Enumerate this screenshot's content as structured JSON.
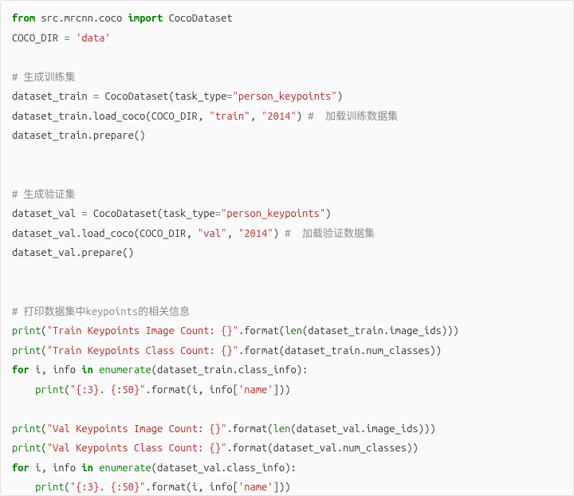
{
  "code": {
    "lines": [
      {
        "html": "<span class='kw'>from</span> src.mrcnn.coco <span class='kw'>import</span> CocoDataset"
      },
      {
        "html": "COCO_DIR <span class='op'>=</span> <span class='str'>'data'</span>"
      },
      {
        "blank": true
      },
      {
        "html": "<span class='cmt'># 生成训练集</span>"
      },
      {
        "html": "dataset_train <span class='op'>=</span> CocoDataset(task_type<span class='op'>=</span><span class='str'>\"person_keypoints\"</span>)"
      },
      {
        "html": "dataset_train.load_coco(COCO_DIR, <span class='str'>\"train\"</span>, <span class='str'>\"2014\"</span>) <span class='cmt'>#  加载训练数据集</span>"
      },
      {
        "html": "dataset_train.prepare()"
      },
      {
        "blank": true
      },
      {
        "blank": true
      },
      {
        "html": "<span class='cmt'># 生成验证集</span>"
      },
      {
        "html": "dataset_val <span class='op'>=</span> CocoDataset(task_type<span class='op'>=</span><span class='str'>\"person_keypoints\"</span>)"
      },
      {
        "html": "dataset_val.load_coco(COCO_DIR, <span class='str'>\"val\"</span>, <span class='str'>\"2014\"</span>) <span class='cmt'>#  加载验证数据集</span>"
      },
      {
        "html": "dataset_val.prepare()"
      },
      {
        "blank": true
      },
      {
        "blank": true
      },
      {
        "html": "<span class='cmt'># 打印数据集中keypoints的相关信息</span>"
      },
      {
        "html": "<span class='nb'>print</span>(<span class='str'>\"Train Keypoints Image Count: {}\"</span>.format(<span class='nb'>len</span>(dataset_train.image_ids)))"
      },
      {
        "html": "<span class='nb'>print</span>(<span class='str'>\"Train Keypoints Class Count: {}\"</span>.format(dataset_train.num_classes))"
      },
      {
        "html": "<span class='kw'>for</span> i, info <span class='kw'>in</span> <span class='nb'>enumerate</span>(dataset_train.class_info):"
      },
      {
        "html": "    <span class='nb'>print</span>(<span class='str'>\"{:3}. {:50}\"</span>.format(i, info[<span class='str'>'name'</span>]))"
      },
      {
        "blank": true
      },
      {
        "html": "<span class='nb'>print</span>(<span class='str'>\"Val Keypoints Image Count: {}\"</span>.format(<span class='nb'>len</span>(dataset_val.image_ids)))"
      },
      {
        "html": "<span class='nb'>print</span>(<span class='str'>\"Val Keypoints Class Count: {}\"</span>.format(dataset_val.num_classes))"
      },
      {
        "html": "<span class='kw'>for</span> i, info <span class='kw'>in</span> <span class='nb'>enumerate</span>(dataset_val.class_info):"
      },
      {
        "html": "    <span class='nb'>print</span>(<span class='str'>\"{:3}. {:50}\"</span>.format(i, info[<span class='str'>'name'</span>]))"
      }
    ]
  }
}
